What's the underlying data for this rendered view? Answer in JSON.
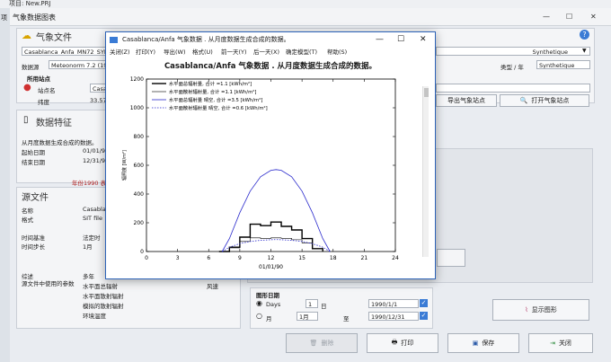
{
  "app": {
    "title": "项目: New.PRJ",
    "window_title": "气象数据图表",
    "left_tab": "项"
  },
  "meteo": {
    "header": "气象文件",
    "file_name": "Casablanca_Anfa_MN72_SYN.MET",
    "synthetic_dropdown": "Synthetique",
    "data_source_label": "数据源",
    "data_source_value": "Meteonorm 7.2 (1986",
    "type_year_label": "类型 / 年",
    "type_year_value": "Synthetique"
  },
  "site": {
    "header": "所用站点",
    "name_label": "站点名",
    "name_value": "Casablanca",
    "lat_label": "纬度",
    "lat_value": "33.57",
    "export_button": "导出气象站点",
    "open_button": "打开气象站点"
  },
  "features": {
    "header": "数据特征",
    "generated": "从月度数据生成合成的数据。",
    "start_label": "起始日期",
    "start_value": "01/01/90",
    "end_label": "结束日期",
    "end_value": "12/31/90",
    "year_note": "年份1990 表"
  },
  "source": {
    "header": "源文件",
    "name_label": "名称",
    "name_value": "Casablan",
    "format_label": "格式",
    "format_value": "SIT file",
    "time_ref_label": "时间基准",
    "time_ref_value": "法定时",
    "time_step_label": "时间步长",
    "time_step_value": "1月",
    "comment_label": "综述",
    "comment_value": "多年",
    "params_label": "源文件中使用的参数",
    "params": [
      "水平面总辐射",
      "水平面散射辐射",
      "模拟的散射辐射",
      "环境温度"
    ],
    "wind_label": "风速"
  },
  "graph_date": {
    "header": "图形日期",
    "days_label": "Days",
    "month_label": "月",
    "days_value": "1",
    "month_value": "1月",
    "at_label": "日",
    "to_label": "至",
    "from_date": "1990/1/1",
    "to_date": "1990/12/31",
    "show_graph_button": "显示图形"
  },
  "bottom_buttons": {
    "delete": "删除",
    "print": "打印",
    "save": "保存",
    "close": "关闭"
  },
  "dialog": {
    "title": "Casablanca/Anfa 气象数据 . 从月度数据生成合成的数据。",
    "menu": [
      "关闭(Z)",
      "打印(Y)",
      "导出(W)",
      "格式(U)",
      "前一天(Y)",
      "后一天(X)",
      "确定模型(T)",
      "帮助(S)"
    ],
    "heading": "Casablanca/Anfa 气象数据 . 从月度数据生成合成的数据。"
  },
  "chart_data": {
    "type": "line",
    "title": "Casablanca/Anfa 气象数据 . 从月度数据生成合成的数据。",
    "xlabel": "01/01/90",
    "ylabel": "辐照度 [W/m²]",
    "xlim": [
      0,
      24
    ],
    "ylim": [
      0,
      1200
    ],
    "xticks": [
      0,
      3,
      6,
      9,
      12,
      15,
      18,
      21,
      24
    ],
    "yticks": [
      0,
      200,
      400,
      600,
      800,
      1000,
      1200
    ],
    "grid": false,
    "legend": "top-left",
    "series": [
      {
        "name": "水平面总辐射量, 合计 =1.1 [kWh/m²]",
        "color": "#000000",
        "style": "step",
        "width": 1.4,
        "x": [
          7,
          8,
          9,
          10,
          11,
          12,
          13,
          14,
          15,
          16,
          17
        ],
        "y": [
          0,
          30,
          100,
          190,
          180,
          205,
          175,
          150,
          90,
          20,
          0
        ]
      },
      {
        "name": "水平面散射辐射量, 合计 =1.1 [kWh/m²]",
        "color": "#000000",
        "style": "step",
        "width": 0.6,
        "x": [
          7,
          8,
          9,
          10,
          11,
          12,
          13,
          14,
          15,
          16,
          17
        ],
        "y": [
          0,
          25,
          70,
          95,
          90,
          95,
          92,
          82,
          60,
          18,
          0
        ]
      },
      {
        "name": "水平面总辐射量 晴空, 合计 =3.5 [kWh/m²]",
        "color": "#2a2acc",
        "style": "solid",
        "width": 0.8,
        "x": [
          7.3,
          8,
          9,
          10,
          11,
          12,
          12.5,
          13,
          14,
          15,
          16,
          17,
          17.7
        ],
        "y": [
          0,
          90,
          270,
          420,
          520,
          565,
          570,
          565,
          520,
          420,
          270,
          90,
          0
        ]
      },
      {
        "name": "水平面散射辐射量 晴空, 合计 =0.6 [kWh/m²]",
        "color": "#2a2acc",
        "style": "dotted",
        "width": 0.8,
        "x": [
          7.3,
          8,
          9,
          10,
          11,
          12,
          12.5,
          13,
          14,
          15,
          16,
          17,
          17.7
        ],
        "y": [
          0,
          30,
          55,
          70,
          78,
          82,
          83,
          82,
          78,
          70,
          55,
          30,
          0
        ]
      }
    ]
  }
}
